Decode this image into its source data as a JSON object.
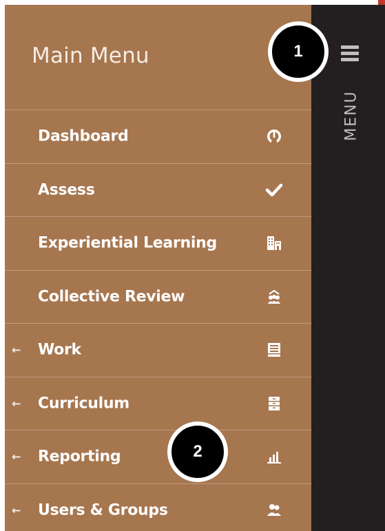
{
  "colors": {
    "sidebar_bg": "#a6764f",
    "menu_strip_bg": "#231f20",
    "text": "#ffffff",
    "callout_bg": "#000000",
    "callout_border": "#ffffff"
  },
  "header": {
    "title": "Main Menu"
  },
  "menu_toggle": {
    "icon": "hamburger-icon",
    "label": "MENU"
  },
  "menu_items": [
    {
      "label": "Dashboard",
      "icon": "gauge-icon",
      "has_arrow": false
    },
    {
      "label": "Assess",
      "icon": "check-icon",
      "has_arrow": false
    },
    {
      "label": "Experiential Learning",
      "icon": "building-icon",
      "has_arrow": false
    },
    {
      "label": "Collective Review",
      "icon": "group-icon",
      "has_arrow": false
    },
    {
      "label": "Work",
      "icon": "inbox-tray-icon",
      "has_arrow": true,
      "arrow": "←"
    },
    {
      "label": "Curriculum",
      "icon": "cabinet-icon",
      "has_arrow": true,
      "arrow": "←"
    },
    {
      "label": "Reporting",
      "icon": "bar-chart-icon",
      "has_arrow": true,
      "arrow": "←"
    },
    {
      "label": "Users & Groups",
      "icon": "users-icon",
      "has_arrow": true,
      "arrow": "←"
    }
  ],
  "callouts": [
    {
      "number": "1"
    },
    {
      "number": "2"
    }
  ]
}
